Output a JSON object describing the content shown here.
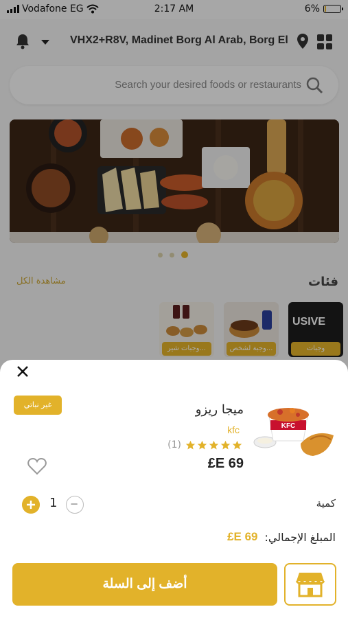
{
  "status_bar": {
    "carrier": "Vodafone EG",
    "time": "2:17 AM",
    "battery": "6%",
    "battery_level": 0.06
  },
  "header": {
    "address": "VHX2+R8V, Madinet Borg Al Arab, Borg El ..."
  },
  "search": {
    "placeholder": "Search your desired foods or restaurants"
  },
  "carousel": {
    "count": 3,
    "active_index": 2
  },
  "categories": {
    "title": "فئات",
    "view_all": "مشاهدة الكل",
    "items": [
      {
        "label": "وجبات"
      },
      {
        "label": "وجبة لشخص..."
      },
      {
        "label": "وجبات شير..."
      }
    ],
    "first_image_text": "USIVE"
  },
  "product": {
    "name": "ميجا ريزو",
    "brand": "kfc",
    "rating_stars": 5,
    "rating_count": "(1)",
    "price": "£E 69",
    "tag": "غير نباتي",
    "logo_text": "KFC"
  },
  "quantity": {
    "label": "كمية",
    "value": "1"
  },
  "total": {
    "label": "المبلغ الإجمالي:",
    "value": "£E 69"
  },
  "actions": {
    "add_to_cart": "أضف إلى السلة"
  },
  "colors": {
    "accent": "#e2b22a"
  }
}
